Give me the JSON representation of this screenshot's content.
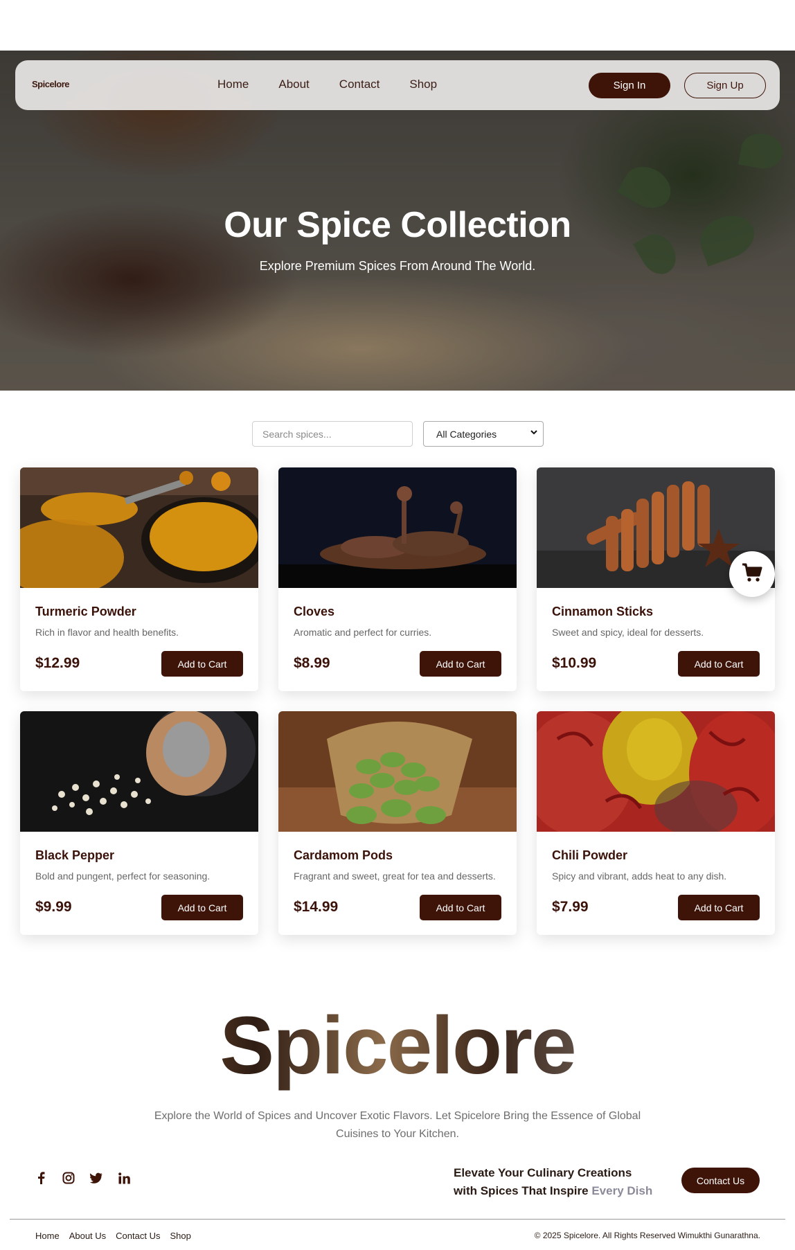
{
  "nav": {
    "logo": "Spicelore",
    "links": [
      "Home",
      "About",
      "Contact",
      "Shop"
    ],
    "sign_in": "Sign In",
    "sign_up": "Sign Up"
  },
  "hero": {
    "title": "Our Spice Collection",
    "subtitle": "Explore Premium Spices From Around The World."
  },
  "filters": {
    "search_placeholder": "Search spices...",
    "category_selected": "All Categories"
  },
  "products": [
    {
      "name": "Turmeric Powder",
      "description": "Rich in flavor and health benefits.",
      "price": "$12.99",
      "button": "Add to Cart"
    },
    {
      "name": "Cloves",
      "description": "Aromatic and perfect for curries.",
      "price": "$8.99",
      "button": "Add to Cart"
    },
    {
      "name": "Cinnamon Sticks",
      "description": "Sweet and spicy, ideal for desserts.",
      "price": "$10.99",
      "button": "Add to Cart"
    },
    {
      "name": "Black Pepper",
      "description": "Bold and pungent, perfect for seasoning.",
      "price": "$9.99",
      "button": "Add to Cart"
    },
    {
      "name": "Cardamom Pods",
      "description": "Fragrant and sweet, great for tea and desserts.",
      "price": "$14.99",
      "button": "Add to Cart"
    },
    {
      "name": "Chili Powder",
      "description": "Spicy and vibrant, adds heat to any dish.",
      "price": "$7.99",
      "button": "Add to Cart"
    }
  ],
  "footer": {
    "brand": "Spicelore",
    "text": "Explore the World of Spices and Uncover Exotic Flavors. Let Spicelore Bring the Essence of Global Cuisines to Your Kitchen.",
    "tagline_line1": "Elevate Your Culinary Creations",
    "tagline_line2": "with Spices That Inspire",
    "tagline_accent": "Every Dish",
    "contact_button": "Contact Us",
    "links": [
      "Home",
      "About Us",
      "Contact Us",
      "Shop"
    ],
    "copyright": "© 2025 Spicelore. All Rights Reserved Wimukthi Gunarathna."
  },
  "icons": {
    "socials": [
      "facebook-icon",
      "instagram-icon",
      "twitter-icon",
      "linkedin-icon"
    ],
    "cart": "cart-icon"
  },
  "colors": {
    "brand": "#3e1409",
    "accent_text": "#8a8a9a"
  }
}
